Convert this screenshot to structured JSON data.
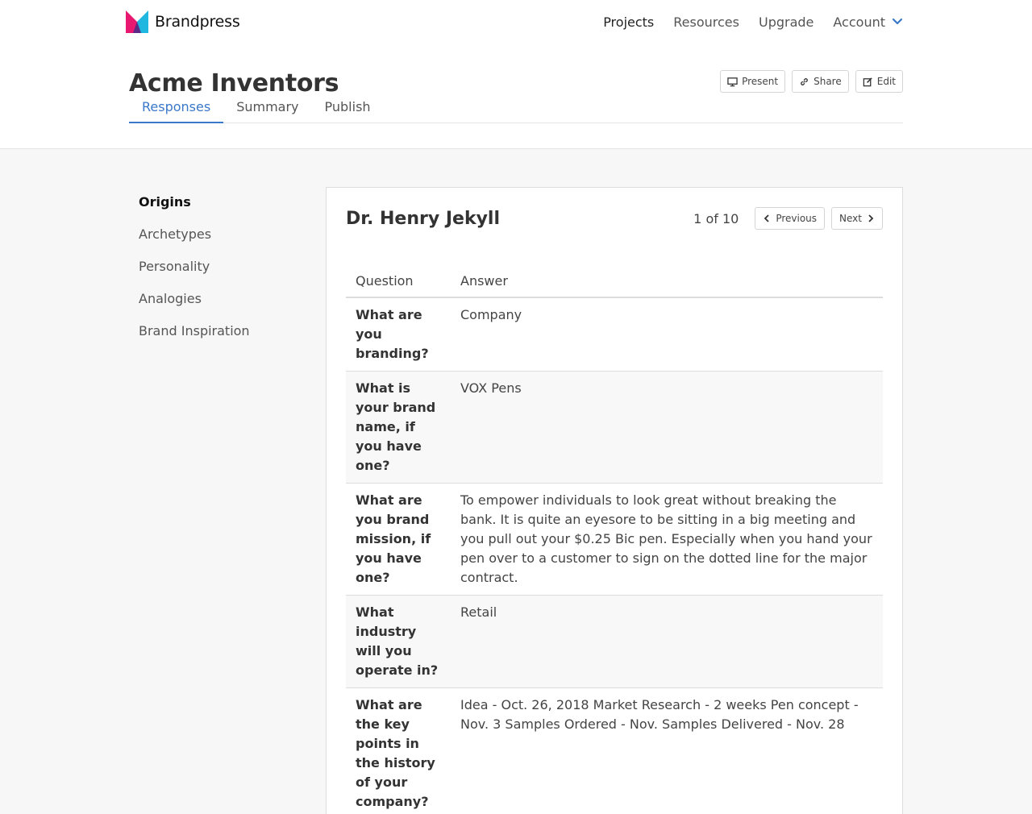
{
  "app": {
    "name": "Brandpress"
  },
  "nav": {
    "links": [
      "Projects",
      "Resources",
      "Upgrade"
    ],
    "account": "Account"
  },
  "page": {
    "title": "Acme Inventors"
  },
  "actions": {
    "present": "Present",
    "share": "Share",
    "edit": "Edit"
  },
  "tabs": [
    "Responses",
    "Summary",
    "Publish"
  ],
  "sidebar": [
    "Origins",
    "Archetypes",
    "Personality",
    "Analogies",
    "Brand Inspiration"
  ],
  "response": {
    "name": "Dr. Henry Jekyll",
    "counter": "1 of 10",
    "previous": "Previous",
    "next": "Next"
  },
  "table": {
    "headers": [
      "Question",
      "Answer"
    ],
    "rows": [
      {
        "q": "What are you branding?",
        "a": "Company"
      },
      {
        "q": "What is your brand name, if you have one?",
        "a": "VOX Pens"
      },
      {
        "q": "What are you brand mission, if you have one?",
        "a": "To empower individuals to look great without breaking the bank. It is quite an eyesore to be sitting in a big meeting and you pull out your $0.25 Bic pen. Especially when you hand your pen over to a customer to sign on the dotted line for the major contract."
      },
      {
        "q": "What industry will you operate in?",
        "a": "Retail"
      },
      {
        "q": "What are the key points in the history of your company?",
        "a": "Idea - Oct. 26, 2018 Market Research - 2 weeks Pen concept - Nov. 3 Samples Ordered - Nov. Samples Delivered - Nov. 28"
      }
    ]
  },
  "colors": {
    "accent": "#3a78c9",
    "logo_pink": "#e8176f",
    "logo_cyan": "#1fb6e0",
    "logo_purple": "#5b2a86"
  }
}
